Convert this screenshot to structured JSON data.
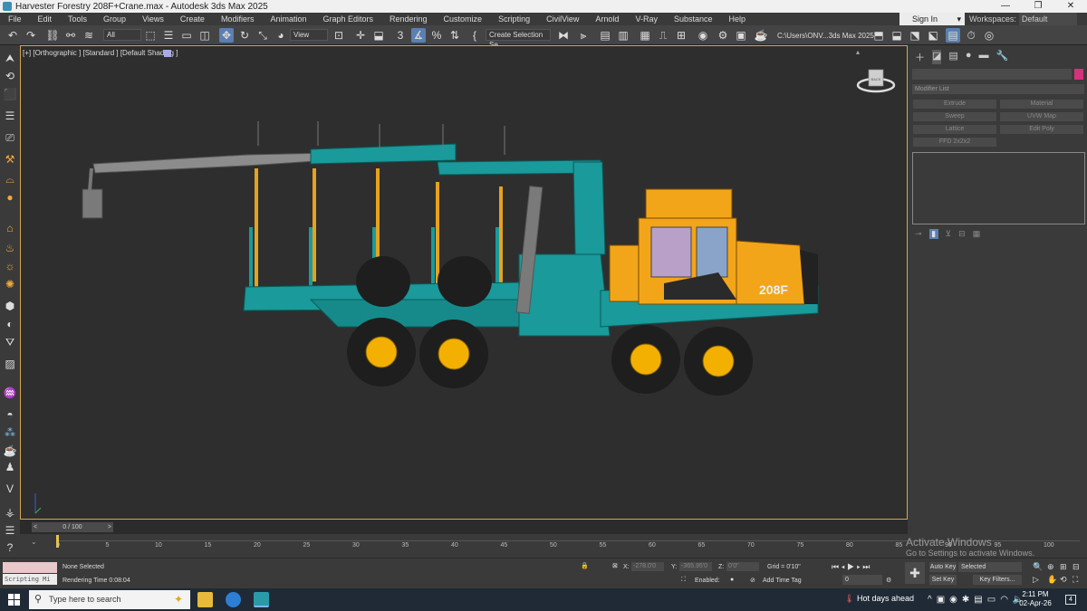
{
  "window": {
    "title": "Harvester Forestry 208F+Crane.max - Autodesk 3ds Max 2025",
    "controls": [
      "—",
      "❐",
      "✕"
    ]
  },
  "menu": [
    "File",
    "Edit",
    "Tools",
    "Group",
    "Views",
    "Create",
    "Modifiers",
    "Animation",
    "Graph Editors",
    "Rendering",
    "Customize",
    "Scripting",
    "CivilView",
    "Arnold",
    "V-Ray",
    "Substance",
    "Help"
  ],
  "account": {
    "sign_in": "Sign In",
    "workspaces_label": "Workspaces:",
    "workspace_value": "Default"
  },
  "toolbar": {
    "filter_value": "All",
    "coord_system": "View",
    "create_selection_set": "Create Selection Se",
    "project_path": "C:\\Users\\ONV...3ds Max 2025"
  },
  "viewport": {
    "label": "[+] [Orthographic ] [Standard ] [Default Shading ]",
    "viewcube_face": "BACK",
    "truck_text": "208F"
  },
  "command_panel": {
    "modifier_list": "Modifier List",
    "buttons": [
      "Extrude",
      "Material",
      "Sweep",
      "UVW Map",
      "Lattice",
      "Edit Poly",
      "FFD 2x2x2"
    ]
  },
  "timeline": {
    "slider": "0 / 100",
    "ticks": [
      "0",
      "5",
      "10",
      "15",
      "20",
      "25",
      "30",
      "35",
      "40",
      "45",
      "50",
      "55",
      "60",
      "65",
      "70",
      "75",
      "80",
      "85",
      "90",
      "95",
      "100"
    ]
  },
  "status": {
    "selection": "None Selected",
    "rendering_time": "Rendering Time  0:08:04",
    "scripting_placeholder": "Scripting Mi",
    "x_label": "X:",
    "x_value": "-278.0'0",
    "y_label": "Y:",
    "y_value": "-365.95'0",
    "z_label": "Z:",
    "z_value": "0'0\"",
    "grid": "Grid = 0'10\"",
    "enabled_label": "Enabled:",
    "add_time_tag": "Add Time Tag",
    "auto_key": "Auto Key",
    "set_key": "Set Key",
    "selected": "Selected",
    "key_filters": "Key Filters...",
    "frame_value": "0"
  },
  "watermark": {
    "line1": "Activate Windows",
    "line2": "Go to Settings to activate Windows."
  },
  "taskbar": {
    "search_placeholder": "Type here to search",
    "weather": "Hot days ahead",
    "time": "2:11 PM",
    "date": "02-Apr-26",
    "notifications": "4"
  },
  "colors": {
    "accent_viewport_border": "#d7a64a",
    "truck_cab": "#f3a51a",
    "truck_body": "#0f8e8e"
  }
}
